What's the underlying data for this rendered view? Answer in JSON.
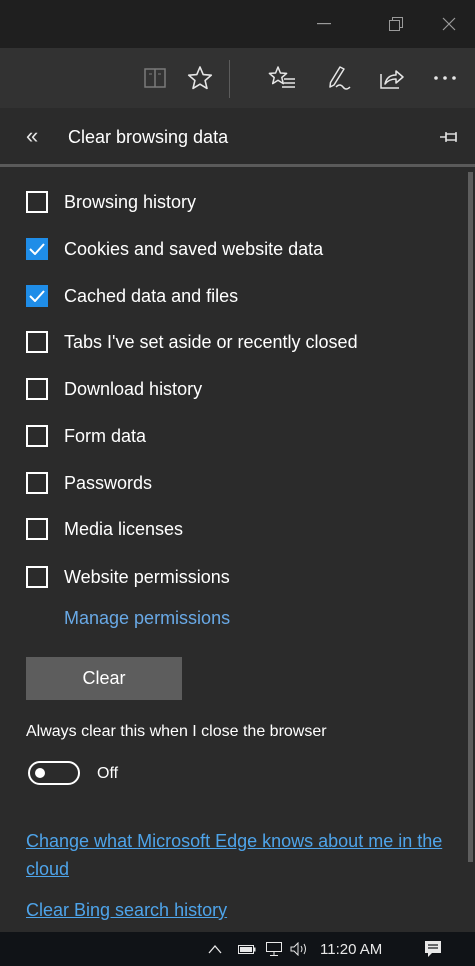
{
  "window": {
    "minimize_icon": "minimize-icon",
    "maximize_icon": "restore-icon",
    "close_icon": "close-icon"
  },
  "toolbar": {
    "icons": [
      "reading-view-icon",
      "favorite-star-icon",
      "favorites-hub-icon",
      "web-note-icon",
      "share-icon",
      "more-icon"
    ]
  },
  "panel": {
    "title": "Clear browsing data",
    "back_icon": "back-double-chevron-icon",
    "pin_icon": "pin-icon"
  },
  "options": [
    {
      "label": "Browsing history",
      "checked": false
    },
    {
      "label": "Cookies and saved website data",
      "checked": true
    },
    {
      "label": "Cached data and files",
      "checked": true
    },
    {
      "label": "Tabs I've set aside or recently closed",
      "checked": false
    },
    {
      "label": "Download history",
      "checked": false
    },
    {
      "label": "Form data",
      "checked": false
    },
    {
      "label": "Passwords",
      "checked": false
    },
    {
      "label": "Media licenses",
      "checked": false
    },
    {
      "label": "Website permissions",
      "checked": false
    }
  ],
  "manage_permissions": "Manage permissions",
  "clear_button": "Clear",
  "always_clear": {
    "label": "Always clear this when I close the browser",
    "state": "Off"
  },
  "links": {
    "edge_cloud": "Change what Microsoft Edge knows about me in the cloud",
    "bing_history": "Clear Bing search history"
  },
  "taskbar": {
    "time": "11:20 AM",
    "icons": [
      "chevron-up-icon",
      "battery-icon",
      "network-icon",
      "volume-icon",
      "notification-icon"
    ]
  },
  "colors": {
    "accent": "#1f8de8",
    "link": "#69a9e6",
    "background": "#2b2b2b"
  }
}
